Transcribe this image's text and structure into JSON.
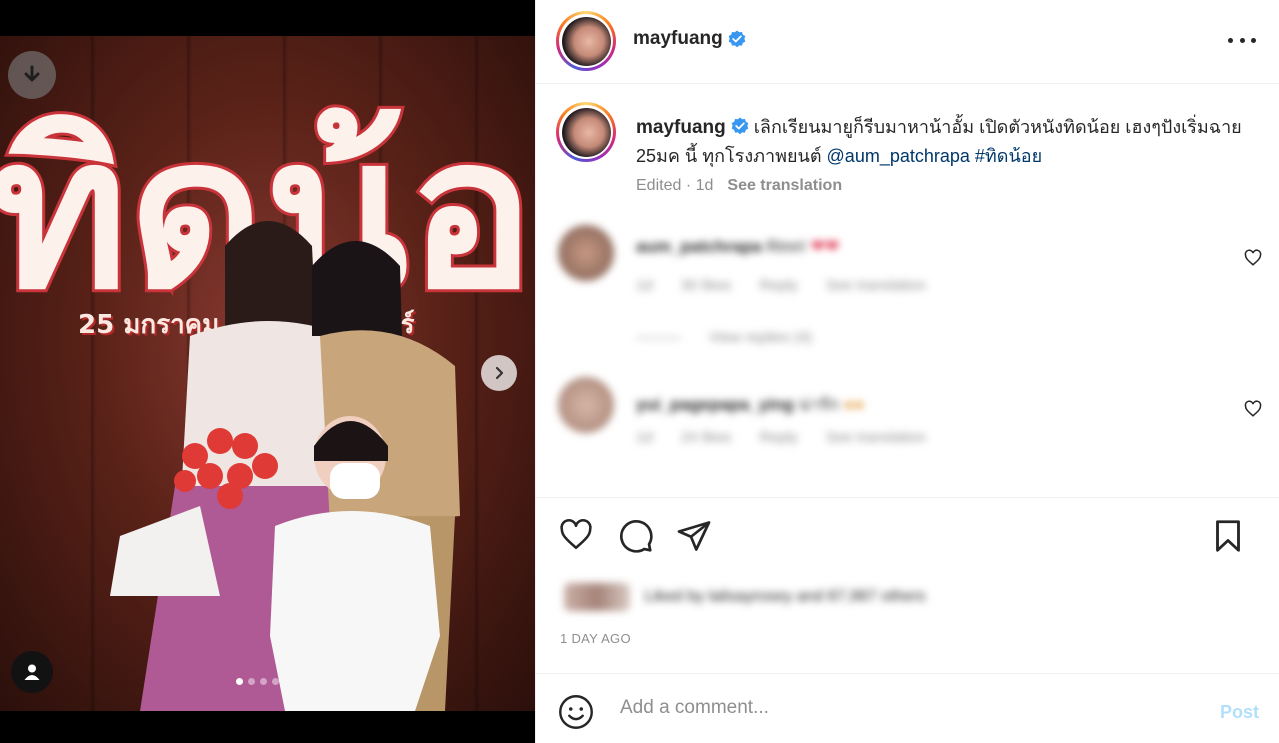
{
  "media": {
    "poster_title_art": "ทิดน้อย",
    "poster_release_text": "25 มกราคม ทุกโรงภาพยนตร์",
    "carousel": {
      "count": 4,
      "active": 0
    }
  },
  "header": {
    "username": "mayfuang",
    "verified": true,
    "more_icon": "more-horizontal-icon"
  },
  "caption": {
    "username": "mayfuang",
    "text": "เลิกเรียนมายูก็รีบมาหาน้าอั้ม เปิดตัวหนังทิดน้อย เฮงๆปังเริ่มฉาย 25มค นี้ ทุกโรงภาพยนต์",
    "mention": "@aum_patchrapa",
    "hashtag": "#ทิดน้อย",
    "edited": "Edited · 1d",
    "see_translation": "See translation"
  },
  "comments": [
    {
      "username": "aum_patchrapa",
      "text": "Rinn!",
      "time": "1d",
      "likes": "30 likes",
      "reply": "Reply",
      "translation": "See translation",
      "view_replies": "View replies (4)"
    },
    {
      "username": "yui_pagepapa_ying",
      "text": "น่ารัก",
      "time": "1d",
      "likes": "24 likes",
      "reply": "Reply",
      "translation": "See translation"
    }
  ],
  "actions": {
    "like_icon": "heart-icon",
    "comment_icon": "comment-icon",
    "share_icon": "share-icon",
    "save_icon": "bookmark-icon",
    "liked_by": "Liked by lalisayrosey and 87,987 others",
    "time_ago": "1 DAY AGO"
  },
  "add_comment": {
    "placeholder": "Add a comment...",
    "post_label": "Post"
  },
  "colors": {
    "link": "#00376b",
    "verified": "#3897f0",
    "muted": "#8e8e8e",
    "post_disabled": "#b2dffc"
  }
}
